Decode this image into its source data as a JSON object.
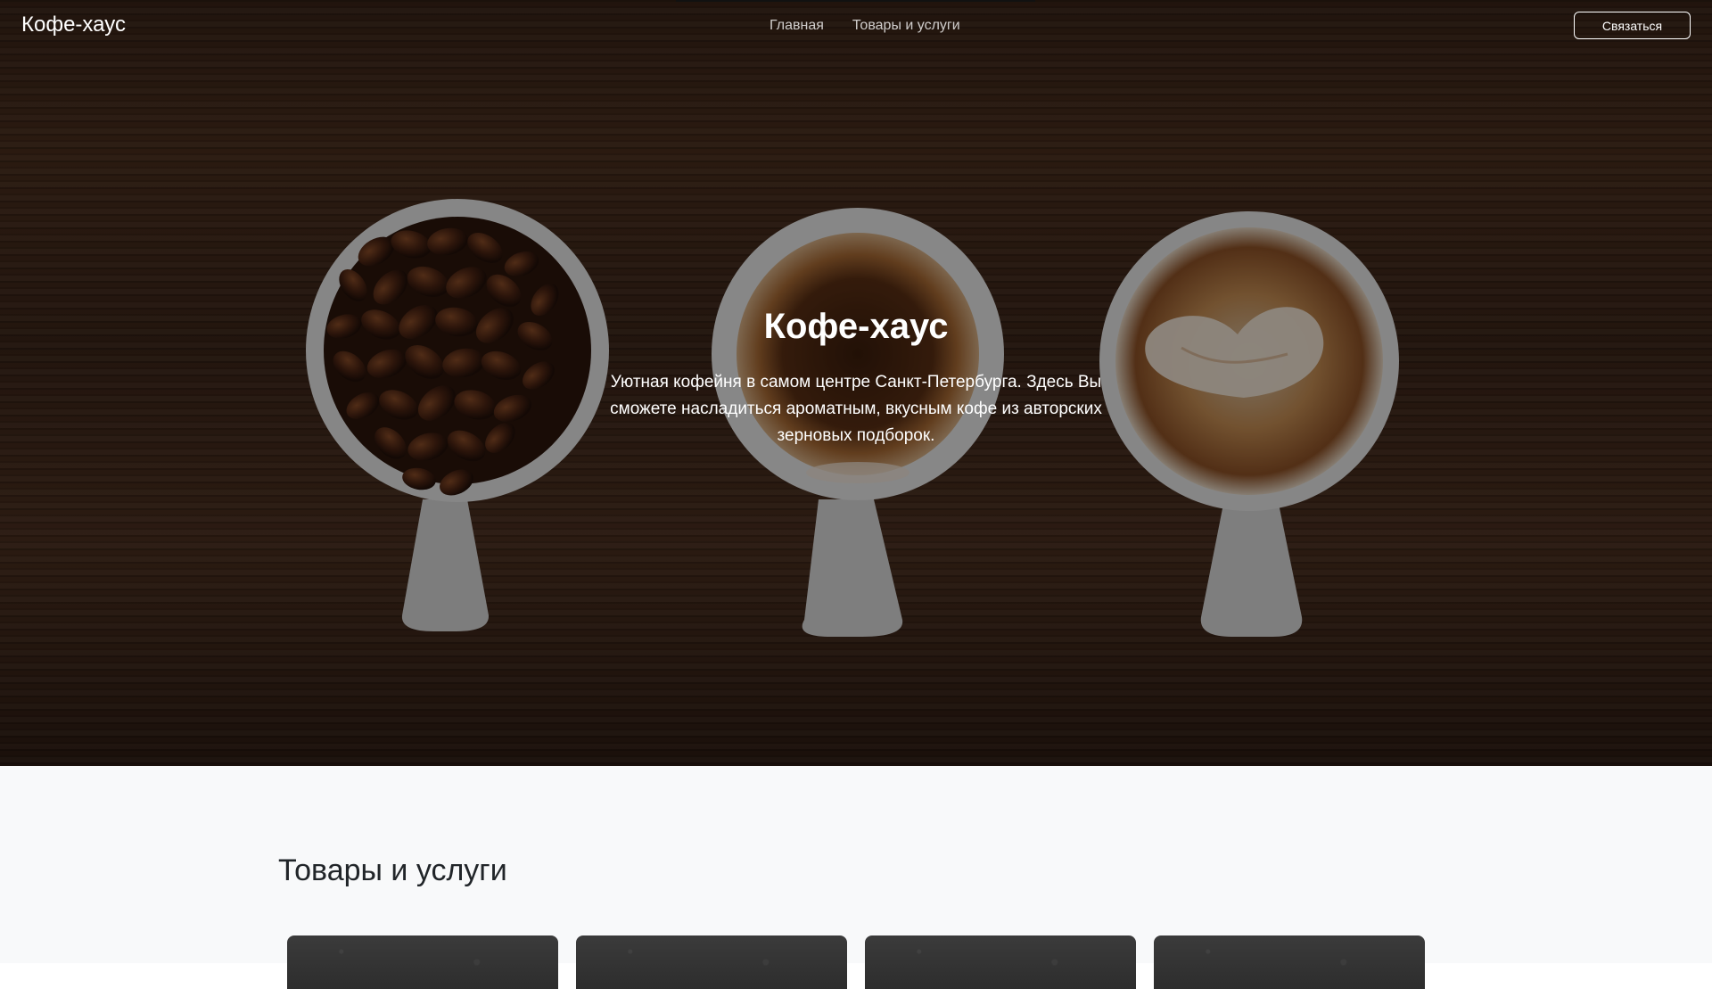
{
  "header": {
    "brand": "Кофе-хаус",
    "nav": [
      "Главная",
      "Товары и услуги"
    ],
    "contact_button": "Связаться"
  },
  "hero": {
    "title": "Кофе-хаус",
    "text": "Уютная кофейня в самом центре Санкт-Петербурга. Здесь Вы сможете насладиться ароматным, вкусным кофе из авторских зерновых подборок."
  },
  "products": {
    "title": "Товары и услуги",
    "cards": [
      {
        "image": "product-image-1"
      },
      {
        "image": "product-image-2"
      },
      {
        "image": "product-image-3"
      },
      {
        "image": "product-image-4"
      }
    ]
  },
  "colors": {
    "light_section_bg": "#f8f9fa",
    "text_dark": "#212529",
    "white": "#ffffff"
  }
}
